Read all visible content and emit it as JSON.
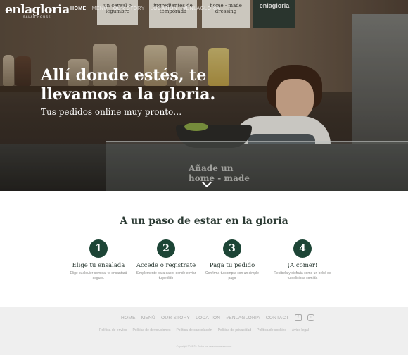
{
  "brand": {
    "logo": "enlagloria",
    "tagline": "SALAD HOUSE"
  },
  "nav": {
    "items": [
      "HOME",
      "MENÚ",
      "OUR STORY",
      "LOCATION",
      "#ENLAGLORIA"
    ],
    "active": "HOME"
  },
  "hero": {
    "title": "Allí donde estés, te llevamos a la gloria.",
    "subtitle": "Tus pedidos online muy pronto…",
    "signs": [
      "un cereal o legumbre",
      "ingredientes de temporada",
      "home - made dressing",
      "enlagloria"
    ],
    "glass_text": "Añade un home - made"
  },
  "steps_section": {
    "title": "A un paso de estar en la gloria",
    "steps": [
      {
        "number": "1",
        "title": "Elige tu ensalada",
        "desc": "Elige cualquier comida, te encantará seguro."
      },
      {
        "number": "2",
        "title": "Accede o registrate",
        "desc": "Simplemente para saber donde enviar tu pedido"
      },
      {
        "number": "3",
        "title": "Paga tu pedido",
        "desc": "Confirma tu compra con un simple pago"
      },
      {
        "number": "4",
        "title": "¡A comer!",
        "desc": "Recíbela y disfruta como un bebé de tu deliciosa comida"
      }
    ]
  },
  "footer": {
    "nav": [
      "HOME",
      "MENÚ",
      "OUR STORY",
      "LOCATION",
      "#ENLAGLORIA",
      "CONTACT"
    ],
    "social_icons": [
      "facebook-icon",
      "instagram-icon"
    ],
    "legal": [
      "Política de envíos",
      "Política de devoluciones",
      "Política de cancelación",
      "Política de privacidad",
      "Política de cookies",
      "Aviso legal"
    ],
    "copyright": "Copyright 2018 © · Todos los derechos reservados"
  },
  "colors": {
    "accent": "#1d4536",
    "text": "#2b3a33",
    "footer_bg": "#efefef"
  }
}
